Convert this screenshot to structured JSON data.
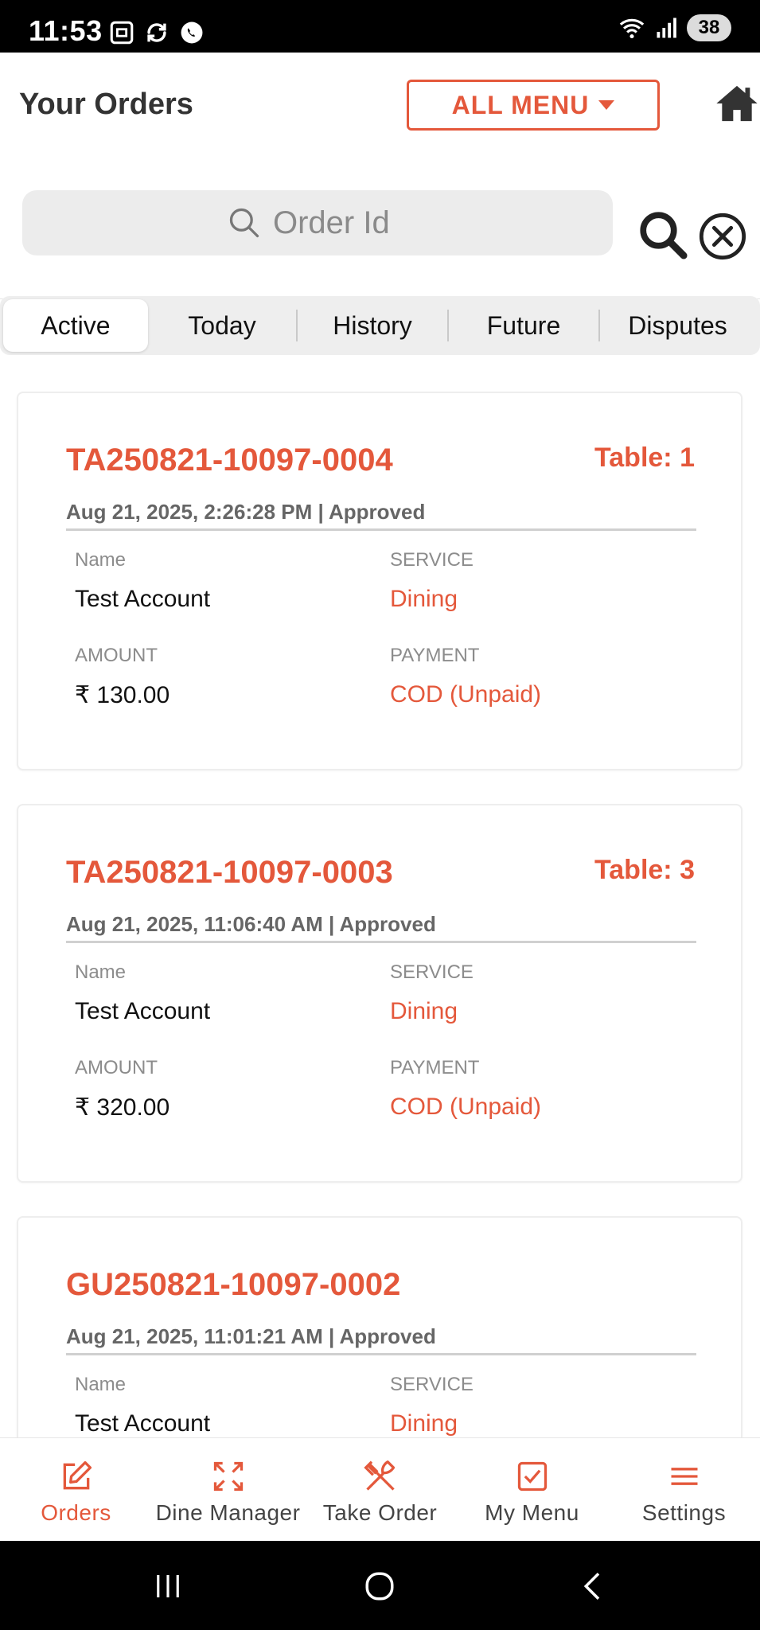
{
  "status_bar": {
    "time": "11:53",
    "battery": "38",
    "icons": [
      "screenshot-icon",
      "sync-icon",
      "whatsapp-icon",
      "wifi-icon",
      "signal-icon"
    ]
  },
  "header": {
    "title": "Your Orders",
    "menu_button": "ALL MENU",
    "home_icon": "home-icon"
  },
  "search": {
    "placeholder": "Order Id"
  },
  "tabs": [
    {
      "label": "Active",
      "active": true
    },
    {
      "label": "Today",
      "active": false
    },
    {
      "label": "History",
      "active": false
    },
    {
      "label": "Future",
      "active": false
    },
    {
      "label": "Disputes",
      "active": false
    }
  ],
  "labels": {
    "name": "Name",
    "service": "SERVICE",
    "amount": "AMOUNT",
    "payment": "PAYMENT"
  },
  "orders": [
    {
      "id": "TA250821-10097-0004",
      "table": "Table: 1",
      "meta": "Aug 21, 2025, 2:26:28 PM | Approved",
      "name": "Test Account",
      "service": "Dining",
      "amount": "₹ 130.00",
      "payment": "COD (Unpaid)"
    },
    {
      "id": "TA250821-10097-0003",
      "table": "Table: 3",
      "meta": "Aug 21, 2025, 11:06:40 AM | Approved",
      "name": "Test Account",
      "service": "Dining",
      "amount": "₹ 320.00",
      "payment": "COD (Unpaid)"
    },
    {
      "id": "GU250821-10097-0002",
      "table": "",
      "meta": "Aug 21, 2025, 11:01:21 AM | Approved",
      "name": "Test Account",
      "service": "Dining",
      "amount": "",
      "payment": ""
    }
  ],
  "bottom_nav": [
    {
      "label": "Orders",
      "icon": "edit-icon",
      "active": true
    },
    {
      "label": "Dine Manager",
      "icon": "expand-icon",
      "active": false
    },
    {
      "label": "Take Order",
      "icon": "cutlery-icon",
      "active": false
    },
    {
      "label": "My Menu",
      "icon": "checkbox-icon",
      "active": false
    },
    {
      "label": "Settings",
      "icon": "menu-icon",
      "active": false
    }
  ],
  "colors": {
    "accent": "#e4583b",
    "text_dark": "#111111",
    "label_grey": "#8c8c8c",
    "tab_bg": "#eeeeee",
    "search_bg": "#ececec"
  }
}
